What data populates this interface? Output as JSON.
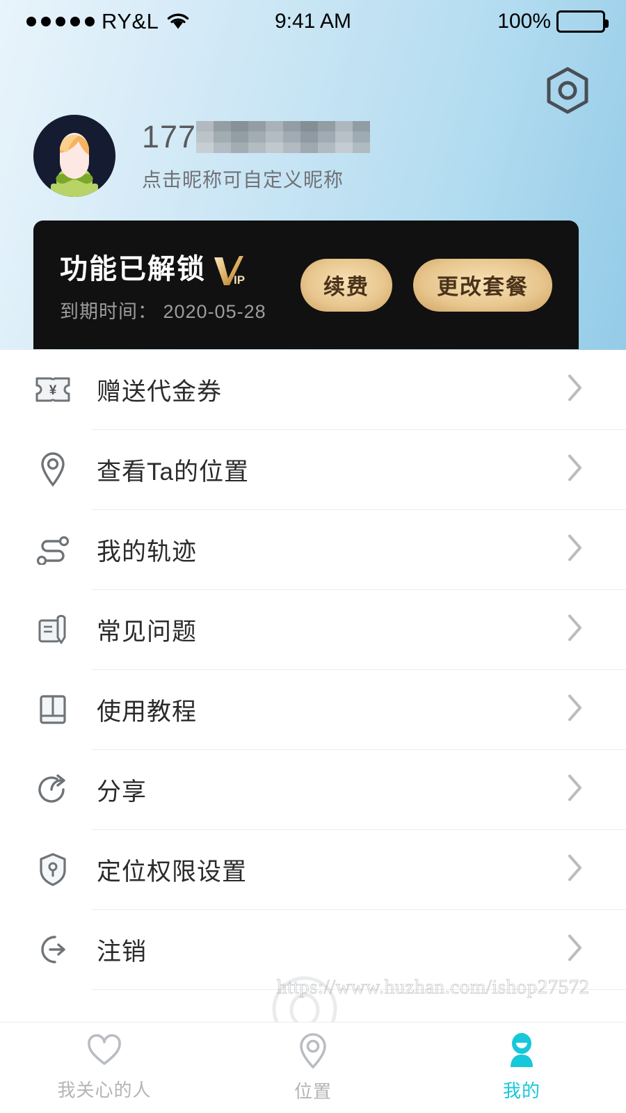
{
  "status_bar": {
    "carrier": "RY&L",
    "signal_dots": 5,
    "wifi_icon": "wifi-icon",
    "time": "9:41 AM",
    "battery_percent": "100%",
    "battery_icon": "battery-full-icon"
  },
  "header": {
    "settings_icon": "settings-hex-icon"
  },
  "profile": {
    "avatar_icon": "user-avatar",
    "phone_prefix": "177",
    "phone_redacted": true,
    "subtitle": "点击昵称可自定义昵称"
  },
  "vip_card": {
    "title": "功能已解锁",
    "logo": "VIP",
    "logo_v": "V",
    "logo_ip": "IP",
    "expiry_label": "到期时间：",
    "expiry_date": "2020-05-28",
    "expiry_full": "到期时间： 2020-05-28",
    "buttons": [
      {
        "label": "续费",
        "name": "renew-button"
      },
      {
        "label": "更改套餐",
        "name": "change-plan-button"
      }
    ],
    "background_color": "#111111",
    "gold_color": "#e8c78f"
  },
  "menu": {
    "items": [
      {
        "label": "赠送代金券",
        "icon": "voucher-ticket-icon",
        "name": "menu-item-voucher"
      },
      {
        "label": "查看Ta的位置",
        "icon": "location-pin-icon",
        "name": "menu-item-view-location"
      },
      {
        "label": "我的轨迹",
        "icon": "route-track-icon",
        "name": "menu-item-my-track"
      },
      {
        "label": "常见问题",
        "icon": "faq-note-icon",
        "name": "menu-item-faq"
      },
      {
        "label": "使用教程",
        "icon": "book-icon",
        "name": "menu-item-tutorial"
      },
      {
        "label": "分享",
        "icon": "share-icon",
        "name": "menu-item-share"
      },
      {
        "label": "定位权限设置",
        "icon": "shield-lock-icon",
        "name": "menu-item-location-permission"
      },
      {
        "label": "注销",
        "icon": "logout-icon",
        "name": "menu-item-logout"
      }
    ],
    "chevron_icon": "chevron-right-icon"
  },
  "tabbar": {
    "active_color": "#17c7da",
    "inactive_color": "#b4b4b4",
    "tabs": [
      {
        "label": "我关心的人",
        "icon": "heart-icon",
        "active": false,
        "name": "tab-people-i-care"
      },
      {
        "label": "位置",
        "icon": "location-pin-icon",
        "active": false,
        "name": "tab-location"
      },
      {
        "label": "我的",
        "icon": "person-icon",
        "active": true,
        "name": "tab-mine"
      }
    ]
  },
  "watermark": {
    "text": "https://www.huzhan.com/ishop27572"
  }
}
